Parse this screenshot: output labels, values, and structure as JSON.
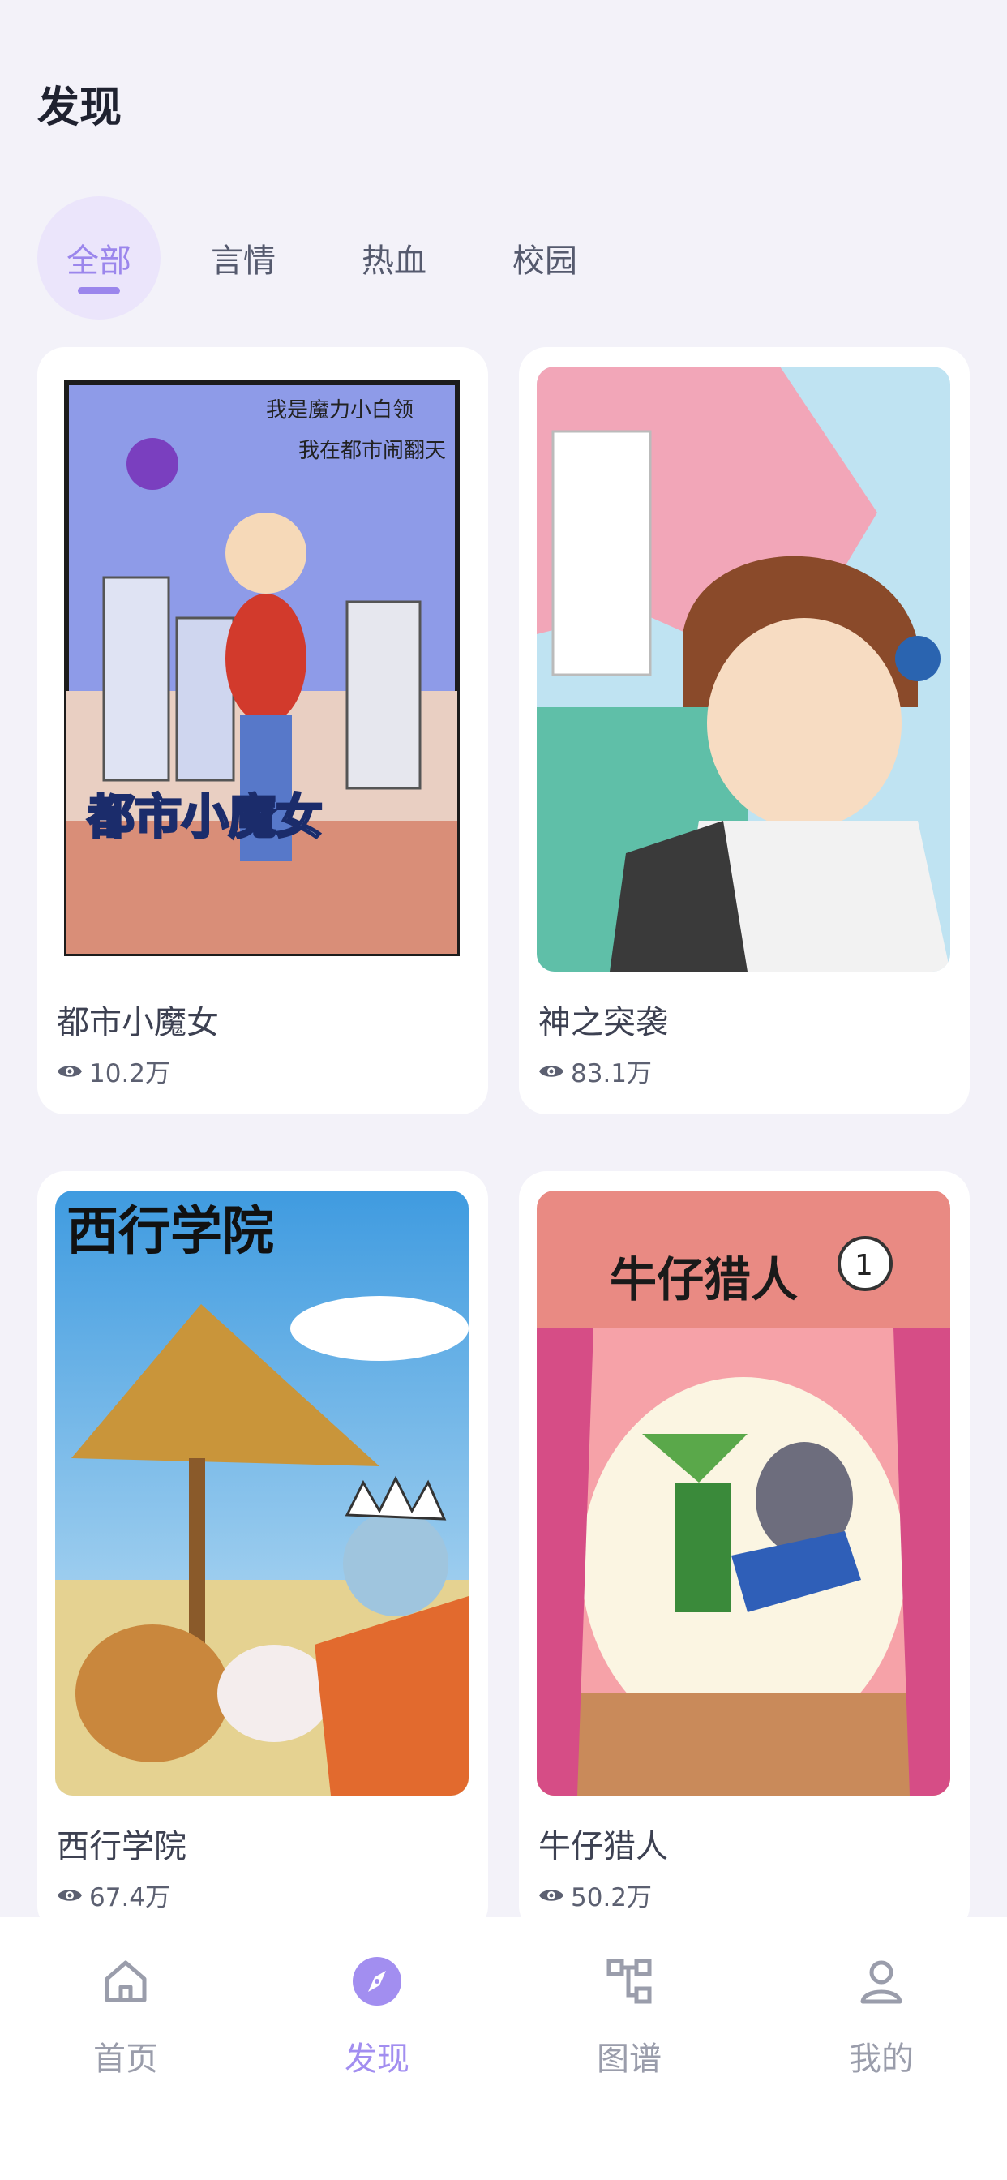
{
  "page": {
    "title": "发现"
  },
  "tabs": [
    {
      "label": "全部"
    },
    {
      "label": "言情"
    },
    {
      "label": "热血"
    },
    {
      "label": "校园"
    }
  ],
  "cards": [
    {
      "title": "都市小魔女",
      "views": "10.2万",
      "cover_text": [
        "我是魔力小白领",
        "我在都市闹翻天",
        "都市小魔女"
      ]
    },
    {
      "title": "神之突袭",
      "views": "83.1万"
    },
    {
      "title": "西行学院",
      "views": "67.4万",
      "cover_text": [
        "西行学院"
      ]
    },
    {
      "title": "牛仔猎人",
      "views": "50.2万",
      "cover_text": [
        "牛仔猎人",
        "1"
      ]
    }
  ],
  "nav": [
    {
      "label": "首页",
      "icon": "home-icon"
    },
    {
      "label": "发现",
      "icon": "compass-icon"
    },
    {
      "label": "图谱",
      "icon": "graph-icon"
    },
    {
      "label": "我的",
      "icon": "user-icon"
    }
  ],
  "colors": {
    "accent": "#9b86ec",
    "background": "#f3f2f9",
    "card": "#ffffff"
  }
}
